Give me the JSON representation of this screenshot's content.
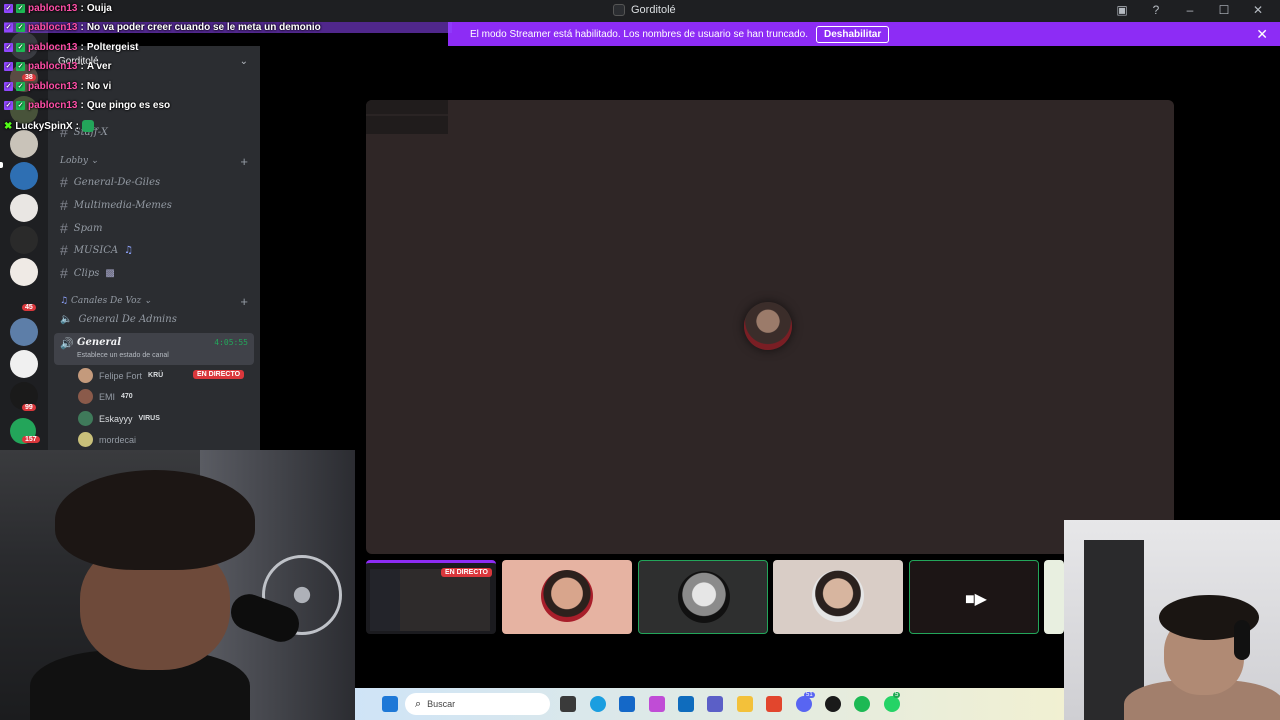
{
  "window": {
    "title": "Gorditolé"
  },
  "banner": {
    "message": "El modo Streamer está habilitado. Los nombres de usuario se han truncado.",
    "disable_label": "Deshabilitar"
  },
  "sidebar": {
    "server_name": "Gorditolé",
    "pinned_channel": "Staff-X",
    "category_lobby": "Lobby",
    "text_channels": [
      "General-De-Giles",
      "Multimedia-Memes",
      "Spam",
      "MUSICA",
      "Clips"
    ],
    "category_voice": "Canales De Voz",
    "voice_channel_admins": "General De Admins",
    "active_voice": {
      "name": "General",
      "status": "Establece un estado de canal",
      "timer": "4:05:55"
    },
    "members": [
      {
        "name": "Felipe Fort",
        "tag": "KRÜ",
        "color": "#c49a7c"
      },
      {
        "name": "EMI",
        "tag": "470",
        "color": "#8a5a4a"
      },
      {
        "name": "Eskayyy",
        "tag": "VIRUS",
        "color": "#3f7a5a"
      },
      {
        "name": "mordecai",
        "tag": "",
        "color": "#c9c07a"
      }
    ],
    "live_label": "EN DIRECTO"
  },
  "rail": {
    "badges": [
      "38",
      "45",
      "99",
      "157"
    ]
  },
  "chat": [
    {
      "user": "pablocn13",
      "text": "Ouija"
    },
    {
      "user": "pablocn13",
      "text": "No va poder creer cuando se le meta un demonio"
    },
    {
      "user": "pablocn13",
      "text": "Poltergeist"
    },
    {
      "user": "pablocn13",
      "text": "A ver"
    },
    {
      "user": "pablocn13",
      "text": "No vi"
    },
    {
      "user": "pablocn13",
      "text": "Que pingo es eso"
    },
    {
      "user": "LuckySpinX",
      "text": ""
    }
  ],
  "stage": {
    "tiles_live_label": "EN DIRECTO"
  },
  "taskbar": {
    "search_placeholder": "Buscar",
    "discord_badge": "51",
    "whatsapp_badge": "5"
  },
  "colors": {
    "accent": "#8d2cf5",
    "live": "#da373c",
    "voice_active": "#23a55a"
  }
}
